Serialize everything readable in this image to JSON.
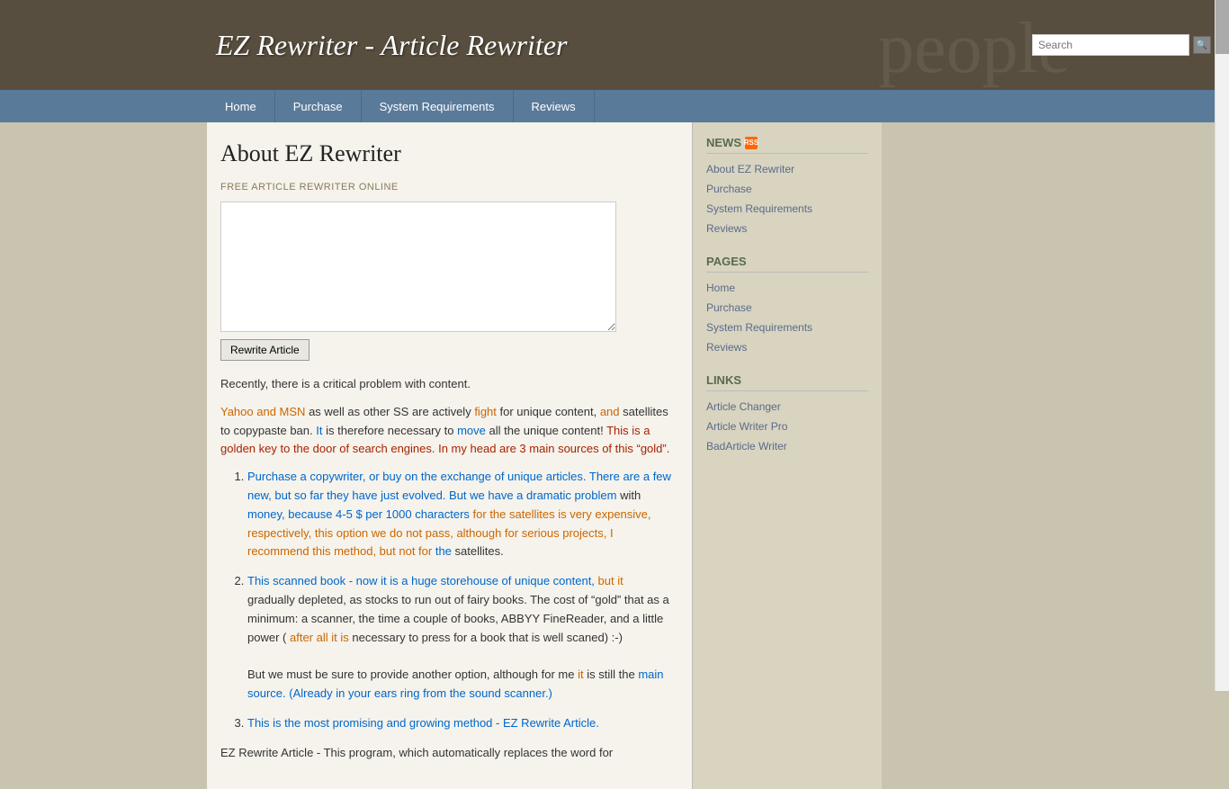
{
  "header": {
    "title": "EZ Rewriter - Article Rewriter",
    "search_placeholder": "Search",
    "search_button_icon": "🔍"
  },
  "nav": {
    "items": [
      {
        "label": "Home",
        "active": false
      },
      {
        "label": "Purchase",
        "active": false
      },
      {
        "label": "System Requirements",
        "active": false
      },
      {
        "label": "Reviews",
        "active": false
      }
    ]
  },
  "content": {
    "heading": "About EZ Rewriter",
    "free_label": "FREE ARTICLE REWRITER ONLINE",
    "textarea_placeholder": "",
    "rewrite_button": "Rewrite Article",
    "body_para1": "Recently, there is a critical problem with content.",
    "body_para2_segment": "Yahoo and MSN as well as other SS are actively fight for unique content, and satellites to copypaste ban. It is therefore necessary to move all the unique content! This is a golden key to the door of search engines. In my head are 3 main sources of this \"gold\".",
    "list_item1": "Purchase a copywriter, or buy on the exchange of unique articles. There are a few new, but so far they have just evolved. But we have a dramatic problem with money, because 4-5 $ per 1000 characters for the satellites is very expensive, respectively, this option we do not pass, although for serious projects, I recommend this method, but not for the satellites.",
    "list_item2_p1": "This scanned book - now it is a huge storehouse of unique content, but it gradually depleted, as stocks to run out of fairy books. The cost of \"gold\" that as a minimum: a scanner, the time a couple of books, ABBYY FineReader, and a little power (after all it is necessary to press for a book that is well scaned) :-)",
    "list_item2_p2": "But we must be sure to provide another option, although for me it is still the main source. (Already in your ears ring from the sound scanner.)",
    "list_item3": "This is the most promising and growing method - EZ Rewrite Article.",
    "footer_text": "EZ Rewrite Article - This program, which automatically replaces the word for"
  },
  "sidebar": {
    "news_title": "NEWS",
    "news_links": [
      {
        "label": "About EZ Rewriter"
      },
      {
        "label": "Purchase"
      },
      {
        "label": "System Requirements"
      },
      {
        "label": "Reviews"
      }
    ],
    "pages_title": "PAGES",
    "pages_links": [
      {
        "label": "Home"
      },
      {
        "label": "Purchase"
      },
      {
        "label": "System Requirements"
      },
      {
        "label": "Reviews"
      }
    ],
    "links_title": "LINKS",
    "links_links": [
      {
        "label": "Article Changer"
      },
      {
        "label": "Article Writer Pro"
      },
      {
        "label": "BadArticle Writer"
      }
    ]
  }
}
